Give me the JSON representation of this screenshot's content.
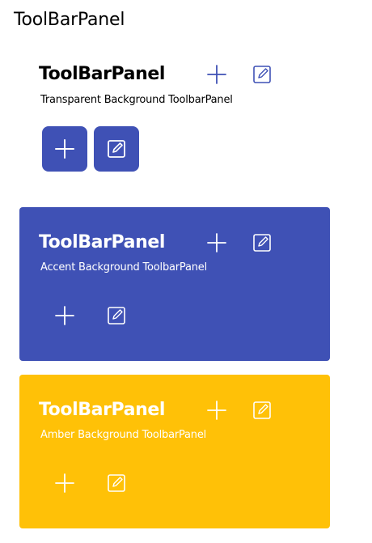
{
  "page": {
    "title": "ToolBarPanel"
  },
  "colors": {
    "accent": "#3f51b5",
    "amber": "#ffc107",
    "white": "#ffffff",
    "text": "#000000"
  },
  "panels": [
    {
      "variant": "transparent",
      "title": "ToolBarPanel",
      "subtitle": "Transparent Background ToolbarPanel",
      "header_icons": [
        "plus-icon",
        "edit-icon"
      ],
      "toolbar_icons": [
        "plus-icon",
        "edit-icon"
      ]
    },
    {
      "variant": "accent",
      "title": "ToolBarPanel",
      "subtitle": "Accent Background ToolbarPanel",
      "header_icons": [
        "plus-icon",
        "edit-icon"
      ],
      "toolbar_icons": [
        "plus-icon",
        "edit-icon"
      ]
    },
    {
      "variant": "amber",
      "title": "ToolBarPanel",
      "subtitle": "Amber Background ToolbarPanel",
      "header_icons": [
        "plus-icon",
        "edit-icon"
      ],
      "toolbar_icons": [
        "plus-icon",
        "edit-icon"
      ]
    }
  ]
}
